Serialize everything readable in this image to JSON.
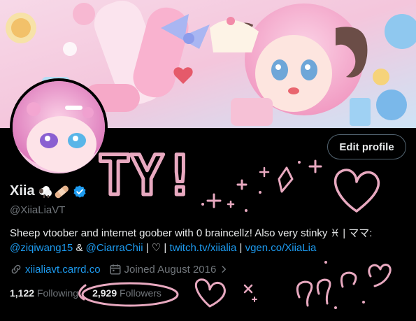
{
  "profile": {
    "display_name": "Xiia",
    "name_emoji": "🐑🩹",
    "handle": "@XiiaLiaVT",
    "edit_button": "Edit profile"
  },
  "bio": {
    "text1": "Sheep vtoober and internet goober with 0 braincellz! Also very stinky ",
    "symbol": "♓",
    "text2": " | ママ:",
    "mention1": "@ziqiwang15",
    "amp": " & ",
    "mention2": "@CiarraChii",
    "sep1": " | ♡ | ",
    "link1": "twitch.tv/xiialia",
    "sep2": " | ",
    "link2": "vgen.co/XiiaLia"
  },
  "meta": {
    "website": "xiialiavt.carrd.co",
    "joined": "Joined August 2016"
  },
  "stats": {
    "following_count": "1,122",
    "following_label": "Following",
    "followers_count": "2,929",
    "followers_label": "Followers"
  },
  "colors": {
    "background": "#000000",
    "text": "#e7e9ea",
    "muted": "#71767b",
    "link": "#1d9bf0",
    "doodle": "#e8a9c0"
  },
  "doodle_text": "TY!"
}
